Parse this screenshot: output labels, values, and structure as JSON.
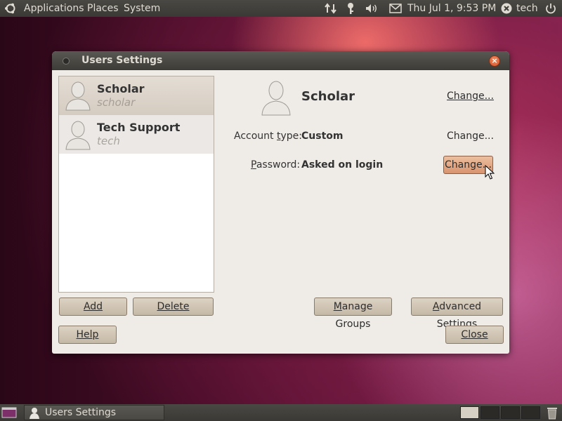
{
  "top_panel": {
    "menus": [
      "Applications",
      "Places",
      "System"
    ],
    "clock": "Thu Jul  1,  9:53 PM",
    "user": "tech"
  },
  "window": {
    "title": "Users Settings",
    "users": [
      {
        "name": "Scholar",
        "login": "scholar",
        "selected": true
      },
      {
        "name": "Tech Support",
        "login": "tech",
        "selected": false
      }
    ],
    "detail": {
      "name": "Scholar",
      "account_type_label": "Account type:",
      "account_type_label_prefix": "Account ",
      "account_type_label_accel": "t",
      "account_type_label_rest": "ype:",
      "account_type_value": "Custom",
      "password_label_accel": "P",
      "password_label_rest": "assword:",
      "password_value": "Asked on login",
      "change_label": "Change..."
    },
    "buttons": {
      "add": "Add",
      "delete": "Delete",
      "manage_groups_accel": "M",
      "manage_groups_rest": "anage Groups",
      "advanced_accel": "A",
      "advanced_rest": "dvanced Settings",
      "help": "Help",
      "close": "Close"
    }
  },
  "bottom_panel": {
    "task_label": "Users Settings"
  },
  "colors": {
    "panel": "#3c3b37",
    "window_bg": "#efebe7",
    "selection": "#d8cfc4",
    "button": "#d2c7b7"
  }
}
